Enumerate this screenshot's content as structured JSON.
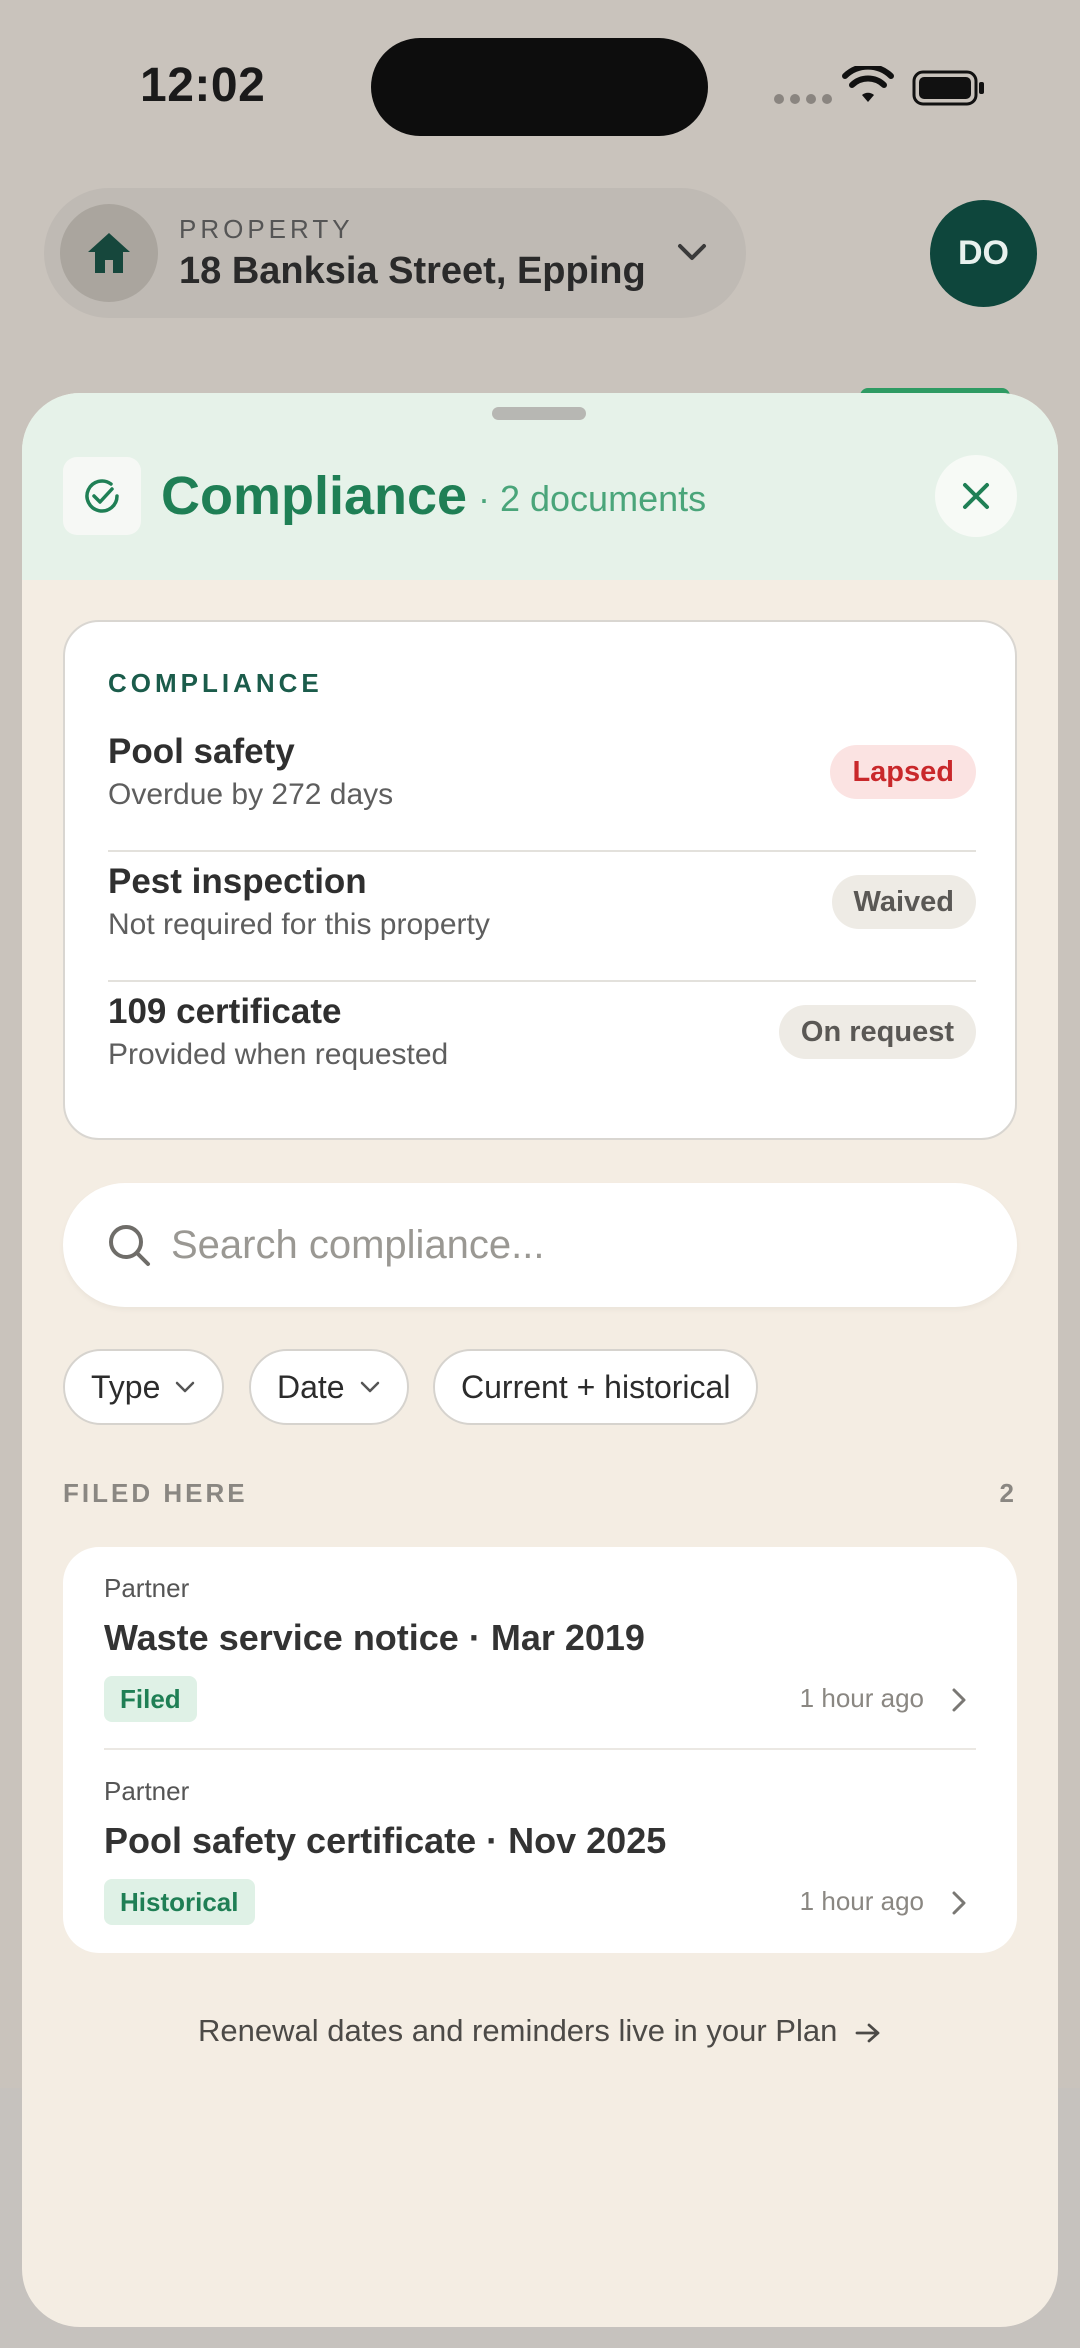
{
  "status_bar": {
    "time": "12:02"
  },
  "header": {
    "property_label": "PROPERTY",
    "property_value": "18 Banksia Street, Epping",
    "avatar_initials": "DO"
  },
  "sheet": {
    "title": "Compliance",
    "count": "· 2 documents"
  },
  "compliance": {
    "heading": "COMPLIANCE",
    "items": [
      {
        "title": "Pool safety",
        "subtitle": "Overdue by 272 days",
        "status": "Lapsed"
      },
      {
        "title": "Pest inspection",
        "subtitle": "Not required for this property",
        "status": "Waived"
      },
      {
        "title": "109 certificate",
        "subtitle": "Provided when requested",
        "status": "On request"
      }
    ]
  },
  "search": {
    "placeholder": "Search compliance..."
  },
  "filters": {
    "type": "Type",
    "date": "Date",
    "scope": "Current + historical"
  },
  "filed": {
    "label": "FILED HERE",
    "count": "2",
    "docs": [
      {
        "source": "Partner",
        "title": "Waste service notice · Mar 2019",
        "badge": "Filed",
        "time": "1 hour ago"
      },
      {
        "source": "Partner",
        "title": "Pool safety certificate · Nov 2025",
        "badge": "Historical",
        "time": "1 hour ago"
      }
    ]
  },
  "footer": {
    "link_text": "Renewal dates and reminders live in your Plan"
  },
  "colors": {
    "brand_green": "#1f7f55",
    "avatar_bg": "#0e463c",
    "lapsed": "#c9282b",
    "sheet_bg": "#f4ede3",
    "sheet_header_bg": "#e6f2e9"
  }
}
